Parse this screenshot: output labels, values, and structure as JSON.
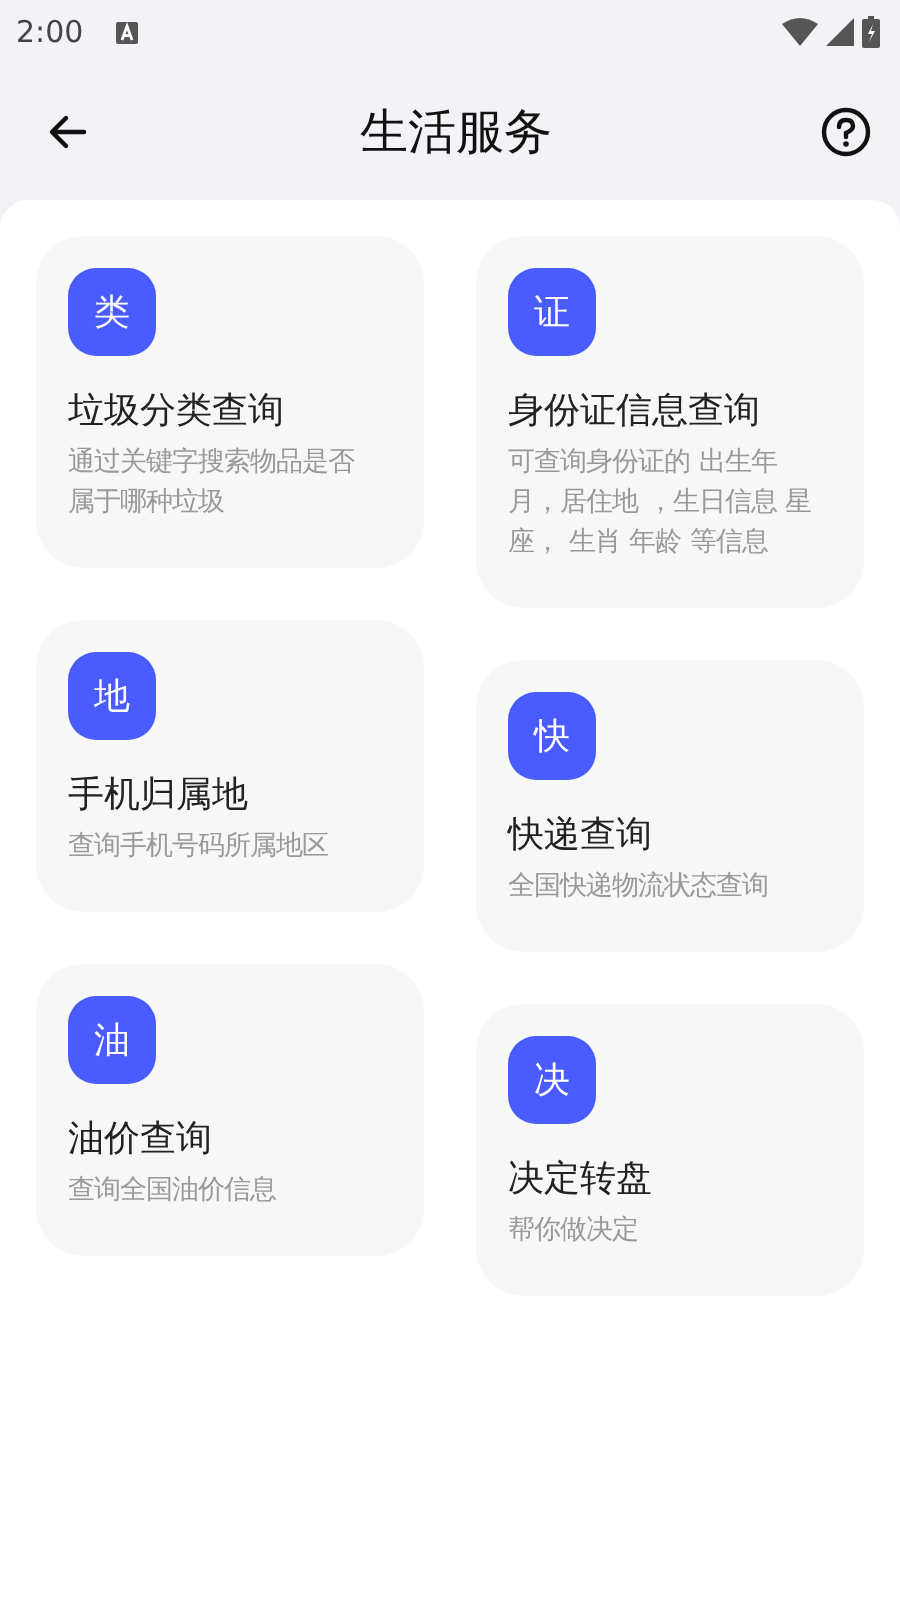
{
  "status_bar": {
    "time": "2:00"
  },
  "header": {
    "title": "生活服务"
  },
  "columns": [
    {
      "cards": [
        {
          "icon": "类",
          "title": "垃圾分类查询",
          "description": "通过关键字搜索物品是否属于哪种垃圾"
        },
        {
          "icon": "地",
          "title": "手机归属地",
          "description": "查询手机号码所属地区"
        },
        {
          "icon": "油",
          "title": "油价查询",
          "description": "查询全国油价信息"
        }
      ]
    },
    {
      "cards": [
        {
          "icon": "证",
          "title": "身份证信息查询",
          "description": "可查询身份证的 出生年月，居住地 ，生日信息 星座， 生肖 年龄 等信息"
        },
        {
          "icon": "快",
          "title": "快递查询",
          "description": "全国快递物流状态查询"
        },
        {
          "icon": "决",
          "title": "决定转盘",
          "description": "帮你做决定"
        }
      ]
    }
  ]
}
